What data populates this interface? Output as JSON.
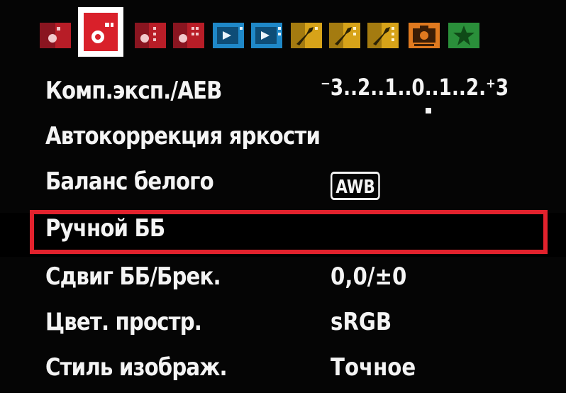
{
  "tabs": [
    {
      "name": "shooting-1",
      "color": "#b81d27",
      "icon": "camera-icon"
    },
    {
      "name": "shooting-2",
      "color": "#d9202a",
      "icon": "camera-icon",
      "active": true
    },
    {
      "name": "shooting-3",
      "color": "#b81d27",
      "icon": "camera-icon"
    },
    {
      "name": "shooting-4",
      "color": "#b81d27",
      "icon": "camera-icon"
    },
    {
      "name": "playback-1",
      "color": "#1f88c8",
      "icon": "playback-icon"
    },
    {
      "name": "playback-2",
      "color": "#1f88c8",
      "icon": "playback-icon"
    },
    {
      "name": "setup-1",
      "color": "#d7a319",
      "icon": "wrench-icon"
    },
    {
      "name": "setup-2",
      "color": "#d7a319",
      "icon": "wrench-icon"
    },
    {
      "name": "setup-3",
      "color": "#d7a319",
      "icon": "wrench-icon"
    },
    {
      "name": "live-view",
      "color": "#e07a1f",
      "icon": "camera-body-icon"
    },
    {
      "name": "my-menu",
      "color": "#2a8f3a",
      "icon": "star-icon"
    }
  ],
  "menu": {
    "exposure_comp": {
      "label": "Комп.эксп./AEB",
      "value": "⁻3..2..1..0..1..2.⁺3"
    },
    "auto_lighting": {
      "label": "Автокоррекция яркости"
    },
    "white_balance": {
      "label": "Баланс белого",
      "value": "AWB"
    },
    "custom_wb": {
      "label": "Ручной ББ"
    },
    "wb_shift": {
      "label": "Сдвиг ББ/Брек.",
      "value": "0,0/±0"
    },
    "color_space": {
      "label": "Цвет. простр.",
      "value": "sRGB"
    },
    "picture_style": {
      "label": "Стиль изображ.",
      "value": "Точное"
    }
  },
  "colors": {
    "selection": "#e2222d",
    "text": "#f4f4f4",
    "background": "#050505"
  }
}
